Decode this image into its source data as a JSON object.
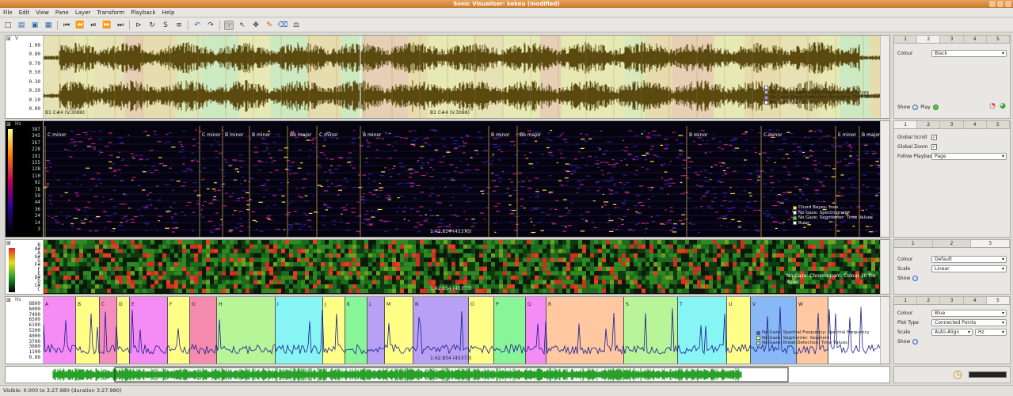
{
  "window": {
    "title": "Sonic Visualiser: kekeu (modified)"
  },
  "menu": [
    "File",
    "Edit",
    "View",
    "Pane",
    "Layer",
    "Transform",
    "Playback",
    "Help"
  ],
  "toolbar_icons": [
    "new-icon",
    "open-icon",
    "save-icon",
    "save-as-icon",
    "rewind-start-icon",
    "rewind-icon",
    "play-icon",
    "fast-forward-icon",
    "ffwd-end-icon",
    "play-selection-icon",
    "loop-icon",
    "solo-icon",
    "align-icon",
    "follow-icon",
    "undo-icon",
    "redo-icon",
    "navigate-icon",
    "select-icon",
    "move-icon",
    "draw-icon",
    "erase-icon",
    "measure-icon"
  ],
  "pane1": {
    "ticks": [
      "1.00",
      "0.80",
      "0.70",
      "0.50",
      "0.30",
      "0.20",
      "0.10",
      "0.00"
    ],
    "unit": "V",
    "left_label": "B1 C#4 (V.3088)",
    "center_label": "B1 C#4 (V.3088)",
    "legend": [
      {
        "label": "Bars",
        "color": "#ffffff"
      },
      {
        "label": "No Gaze: Adaptive Spectrogram: Time Values",
        "color": "#aaaaff"
      },
      {
        "label": "No Gaze: Break Detection: Boundary: Time Values",
        "color": "#cc77cc"
      },
      {
        "label": "No Gaze: Waveform",
        "color": "#ffffff"
      }
    ]
  },
  "pane2": {
    "ticks": [
      "387",
      "345",
      "267",
      "228",
      "191",
      "155",
      "128",
      "110",
      "92",
      "78",
      "59",
      "44",
      "36",
      "24",
      "14",
      "3"
    ],
    "unit": "Hz",
    "chord_labels": [
      "C minor",
      "C minor",
      "B minor",
      "B minor",
      "Bb major",
      "C minor",
      "B minor",
      "B minor",
      "Bb major",
      "B minor",
      "C minor",
      "E minor",
      "B major"
    ],
    "legend": [
      {
        "label": "Chord Bayes: mov",
        "color": "#ffff00"
      },
      {
        "label": "No Gaze: Spectrogram",
        "color": "#ffffff"
      },
      {
        "label": "No Gaze: Segmenter: Time Values",
        "color": "#00ff00"
      },
      {
        "label": "Ruler",
        "color": "#ffffff"
      }
    ],
    "center_label": "1:42.854 (45373)"
  },
  "pane3": {
    "ticks": [
      "B",
      "A#",
      "A",
      "G#",
      "G",
      "F#",
      "F",
      "E",
      "D#",
      "D",
      "C#",
      "C"
    ],
    "legend_label": "No Gaze: Chromagram: Colour 30 file",
    "legend2": "Ruler",
    "center_label": "1:42.854 (45373)"
  },
  "pane4": {
    "unit": "Hz",
    "ticks": [
      "8800",
      "6000",
      "7400",
      "6500",
      "6100",
      "5300",
      "4000",
      "3700",
      "3080",
      "1100",
      "0.00"
    ],
    "segments": [
      {
        "label": "A",
        "color": "#f58cf5",
        "w": 41
      },
      {
        "label": "B",
        "color": "#ffff88",
        "w": 30
      },
      {
        "label": "C",
        "color": "#f58cc0",
        "w": 22
      },
      {
        "label": "D",
        "color": "#ffff88",
        "w": 16
      },
      {
        "label": "E",
        "color": "#f58cf5",
        "w": 48
      },
      {
        "label": "F",
        "color": "#ffff88",
        "w": 28
      },
      {
        "label": "G",
        "color": "#f58cb0",
        "w": 34
      },
      {
        "label": "H",
        "color": "#b8f598",
        "w": 74
      },
      {
        "label": "I",
        "color": "#88f5f5",
        "w": 60
      },
      {
        "label": "J",
        "color": "#ffff88",
        "w": 28
      },
      {
        "label": "K",
        "color": "#88f598",
        "w": 28
      },
      {
        "label": "L",
        "color": "#b8a0f5",
        "w": 22
      },
      {
        "label": "M",
        "color": "#ffff88",
        "w": 36
      },
      {
        "label": "N",
        "color": "#b8a0f5",
        "w": 70
      },
      {
        "label": "O",
        "color": "#ffff88",
        "w": 32
      },
      {
        "label": "P",
        "color": "#88f598",
        "w": 40
      },
      {
        "label": "Q",
        "color": "#f58cf5",
        "w": 26
      },
      {
        "label": "R",
        "color": "#ffc8a0",
        "w": 98
      },
      {
        "label": "S",
        "color": "#b8f598",
        "w": 68
      },
      {
        "label": "T",
        "color": "#88f5f5",
        "w": 62
      },
      {
        "label": "U",
        "color": "#ffff88",
        "w": 30
      },
      {
        "label": "V",
        "color": "#88b8f5",
        "w": 58
      },
      {
        "label": "W",
        "color": "#ffc8a0",
        "w": 40
      }
    ],
    "legend": [
      {
        "label": "No Gaze: Spectral Frequency: Spectral Frequency",
        "color": "#4444ff"
      },
      {
        "label": "No Gaze: Segmenter: Segment",
        "color": "#ffff88"
      },
      {
        "label": "No Gaze: Break Detection: Time Values",
        "color": "#88ff88"
      }
    ],
    "center_label": "1:42.854 (45373)"
  },
  "props1": {
    "tabs": [
      "1",
      "2",
      "3",
      "4",
      "5"
    ],
    "colour_label": "Colour",
    "colour_value": "Black",
    "show_label": "Show",
    "play_label": "Play"
  },
  "props2": {
    "tabs": [
      "1",
      "2",
      "3",
      "4",
      "5"
    ],
    "global_scroll": "Global Scroll",
    "global_zoom": "Global Zoom",
    "follow_label": "Follow Playback",
    "follow_value": "Page"
  },
  "props3": {
    "tabs": [
      "1",
      "2",
      "3"
    ],
    "colour_label": "Colour",
    "colour_value": "Default",
    "scale_label": "Scale",
    "scale_value": "Linear",
    "show_label": "Show"
  },
  "props4": {
    "tabs": [
      "1",
      "2",
      "3",
      "4",
      "5"
    ],
    "colour_label": "Colour",
    "colour_value": "Blue",
    "plot_label": "Plot Type",
    "plot_value": "Connected Points",
    "scale_label": "Scale",
    "scale_value": "Auto-Align",
    "scale_unit": "Hz",
    "show_label": "Show"
  },
  "status": {
    "text": "Visible: 0.000 to 3:27.980 (duration 3:27.980)"
  }
}
